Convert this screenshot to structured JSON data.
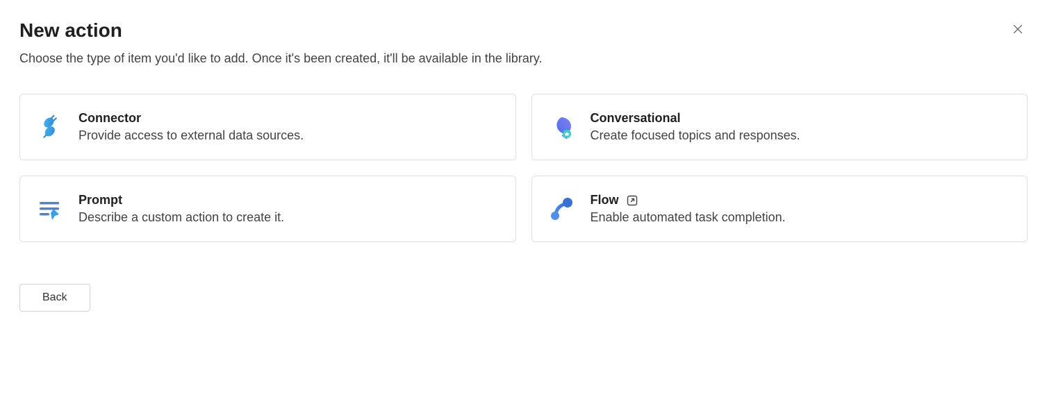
{
  "header": {
    "title": "New action",
    "subtitle": "Choose the type of item you'd like to add. Once it's been created, it'll be available in the library."
  },
  "cards": {
    "connector": {
      "title": "Connector",
      "desc": "Provide access to external data sources."
    },
    "conversational": {
      "title": "Conversational",
      "desc": "Create focused topics and responses."
    },
    "prompt": {
      "title": "Prompt",
      "desc": "Describe a custom action to create it."
    },
    "flow": {
      "title": "Flow",
      "desc": "Enable automated task completion."
    }
  },
  "footer": {
    "back_label": "Back"
  }
}
